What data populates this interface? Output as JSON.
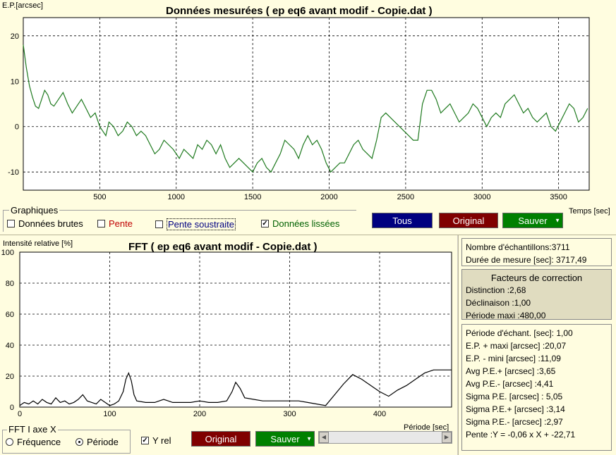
{
  "top_chart": {
    "title": "Données mesurées ( ep eq6 avant modif - Copie.dat )",
    "y_unit": "E.P.[arcsec]",
    "x_unit": "Temps [sec]",
    "line_color": "#1f7a1f"
  },
  "graphiques": {
    "label": "Graphiques",
    "raw": "Données brutes",
    "slope": "Pente",
    "slope_sub": "Pente soustraite",
    "smoothed": "Données lissées",
    "raw_checked": false,
    "slope_checked": false,
    "slope_sub_checked": false,
    "smoothed_checked": true,
    "smoothed_mark": "✓"
  },
  "top_buttons": {
    "tous": "Tous",
    "original": "Original",
    "sauver": "Sauver",
    "dropdown_icon": "triangle-down"
  },
  "fft_chart": {
    "title": "FFT ( ep eq6 avant modif - Copie.dat )",
    "y_unit": "Intensité relative [%]",
    "x_unit": "Période [sec]",
    "line_color": "#000000"
  },
  "fft_axis": {
    "label": "FFT I axe X",
    "freq": "Fréquence",
    "period": "Période",
    "freq_selected": false,
    "period_selected": true
  },
  "yrel": {
    "label": "Y rel",
    "checked": true,
    "mark": "✓"
  },
  "bottom_buttons": {
    "original": "Original",
    "sauver": "Sauver",
    "dropdown_icon": "triangle-down"
  },
  "scrollbar": {
    "left_arrow": "◀",
    "right_arrow": "▶"
  },
  "info1": {
    "lines": [
      "Nombre d'échantillons:3711",
      "Durée de mesure [sec]: 3717,49"
    ]
  },
  "info2": {
    "heading": "Facteurs de correction",
    "lines": [
      "Distinction :2,68",
      "Déclinaison :1,00",
      "Période maxi :480,00"
    ]
  },
  "info3": {
    "lines": [
      "Période d'échant. [sec]: 1,00",
      "E.P. + maxi [arcsec] :20,07",
      "E.P. - mini [arcsec] :11,09",
      "Avg P.E.+ [arcsec] :3,65",
      "Avg P.E.- [arcsec] :4,41",
      "Sigma P.E. [arcsec] : 5,05",
      "Sigma P.E.+ [arcsec] :3,14",
      "Sigma P.E.- [arcsec] :2,97",
      "Pente :Y = -0,06 x X + -22,71"
    ]
  },
  "colors": {
    "navy": "#000080",
    "maroon": "#800000",
    "green": "#008000",
    "panel": "#fffde0"
  },
  "chart_data": [
    {
      "type": "line",
      "title": "Données mesurées ( ep eq6 avant modif - Copie.dat )",
      "ylabel": "E.P.[arcsec]",
      "xlabel": "Temps [sec]",
      "xlim": [
        0,
        3700
      ],
      "ylim": [
        -14,
        24
      ],
      "x_ticks": [
        500,
        1000,
        1500,
        2000,
        2500,
        3000,
        3500
      ],
      "y_ticks": [
        -10,
        0,
        10,
        20
      ],
      "grid": true,
      "x": [
        0,
        20,
        40,
        60,
        80,
        100,
        120,
        140,
        160,
        180,
        200,
        230,
        260,
        290,
        320,
        350,
        380,
        410,
        440,
        470,
        500,
        520,
        540,
        560,
        590,
        620,
        650,
        680,
        710,
        740,
        770,
        800,
        830,
        860,
        890,
        920,
        950,
        980,
        1000,
        1020,
        1050,
        1080,
        1110,
        1140,
        1170,
        1200,
        1230,
        1260,
        1290,
        1320,
        1350,
        1380,
        1410,
        1440,
        1470,
        1500,
        1530,
        1560,
        1590,
        1620,
        1650,
        1680,
        1710,
        1740,
        1770,
        1800,
        1830,
        1860,
        1890,
        1920,
        1950,
        1980,
        2010,
        2040,
        2070,
        2100,
        2130,
        2160,
        2190,
        2220,
        2250,
        2280,
        2310,
        2340,
        2370,
        2400,
        2430,
        2460,
        2490,
        2520,
        2550,
        2580,
        2610,
        2640,
        2670,
        2700,
        2730,
        2760,
        2790,
        2820,
        2850,
        2880,
        2910,
        2940,
        2970,
        3000,
        3030,
        3060,
        3090,
        3120,
        3150,
        3180,
        3210,
        3240,
        3270,
        3300,
        3330,
        3360,
        3390,
        3420,
        3450,
        3480,
        3510,
        3540,
        3570,
        3600,
        3630,
        3660,
        3690
      ],
      "y": [
        18,
        13,
        9,
        6.5,
        4.5,
        4,
        6,
        8,
        7,
        5,
        4.5,
        6,
        7.5,
        5,
        3,
        4.5,
        6,
        4,
        2,
        3,
        0,
        -1,
        -2,
        1,
        0,
        -2,
        -1,
        1,
        0,
        -2,
        -1,
        -2,
        -4,
        -6,
        -5,
        -3,
        -4,
        -5,
        -6,
        -7,
        -5,
        -6,
        -7,
        -4,
        -5,
        -3,
        -4,
        -6,
        -4,
        -7,
        -9,
        -8,
        -7,
        -8,
        -9,
        -10,
        -8,
        -7,
        -9,
        -10,
        -8,
        -6,
        -3,
        -4,
        -5,
        -7,
        -4,
        -2,
        -4,
        -3,
        -5,
        -8,
        -10,
        -9,
        -8,
        -8,
        -6,
        -4,
        -3,
        -5,
        -6,
        -7,
        -3,
        2,
        3,
        2,
        1,
        0,
        -1,
        -2,
        -3,
        -3,
        5,
        8,
        8,
        6,
        3,
        4,
        5,
        3,
        1,
        2,
        3,
        5,
        4,
        2,
        0,
        2,
        3,
        2,
        5,
        6,
        7,
        5,
        3,
        4,
        2,
        1,
        2,
        3,
        0,
        -1,
        1,
        3,
        5,
        4,
        1,
        2,
        4
      ]
    },
    {
      "type": "line",
      "title": "FFT ( ep eq6 avant modif - Copie.dat )",
      "ylabel": "Intensité relative [%]",
      "xlabel": "Période [sec]",
      "xlim": [
        0,
        480
      ],
      "ylim": [
        0,
        100
      ],
      "x_ticks": [
        0,
        100,
        200,
        300,
        400
      ],
      "y_ticks": [
        0,
        20,
        40,
        60,
        80,
        100
      ],
      "grid": true,
      "x": [
        0,
        5,
        10,
        15,
        20,
        25,
        30,
        35,
        40,
        45,
        50,
        55,
        60,
        65,
        70,
        75,
        80,
        85,
        90,
        95,
        100,
        105,
        110,
        115,
        118,
        121,
        124,
        127,
        130,
        140,
        150,
        155,
        160,
        165,
        170,
        180,
        190,
        200,
        210,
        220,
        230,
        236,
        240,
        245,
        250,
        260,
        270,
        280,
        290,
        300,
        310,
        320,
        330,
        340,
        350,
        360,
        370,
        380,
        390,
        400,
        410,
        420,
        430,
        440,
        450,
        460,
        470,
        480
      ],
      "y": [
        1,
        3,
        2,
        4,
        2,
        5,
        3,
        2,
        6,
        3,
        4,
        2,
        3,
        5,
        8,
        4,
        3,
        2,
        5,
        3,
        1,
        2,
        4,
        10,
        18,
        22,
        17,
        8,
        4,
        3,
        3,
        4,
        5,
        4,
        3,
        3,
        3,
        4,
        3,
        3,
        4,
        10,
        16,
        12,
        6,
        5,
        4,
        4,
        4,
        4,
        4,
        3,
        2,
        1,
        8,
        15,
        21,
        18,
        14,
        10,
        7,
        11,
        14,
        18,
        22,
        24,
        24,
        24
      ]
    }
  ]
}
